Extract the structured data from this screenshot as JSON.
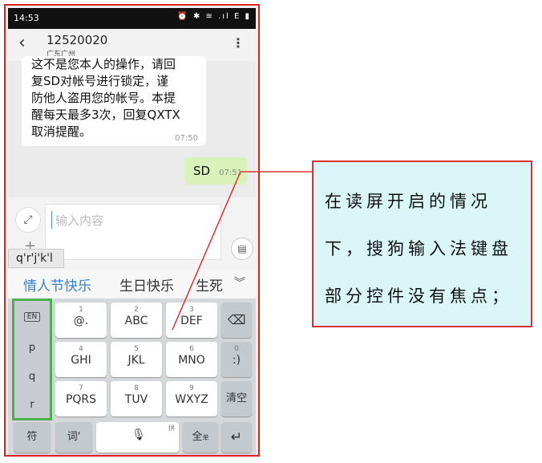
{
  "status": {
    "time": "14:53",
    "icons": "⏰ ✱ ≋ .ıl E ▮"
  },
  "appbar": {
    "number": "12520020",
    "location": "广东广州"
  },
  "messages": {
    "incoming": {
      "lines": [
        "这不是您本人的操作，请回",
        "复SD对帐号进行锁定，谨",
        "防他人盗用您的帐号。本提",
        "醒每天最多3次，回复QXTX",
        "取消提醒。"
      ],
      "time": "07:50"
    },
    "outgoing": {
      "text": "SD",
      "time": "07:51"
    }
  },
  "composer": {
    "placeholder": "输入内容"
  },
  "ime": {
    "pinyin": "q'r'j'k'l",
    "candidates": [
      "情人节快乐",
      "生日快乐",
      "生死"
    ],
    "side": [
      "EN",
      "p",
      "q",
      "r"
    ],
    "keys": [
      {
        "num": "1",
        "lbl": "@."
      },
      {
        "num": "2",
        "lbl": "ABC"
      },
      {
        "num": "3",
        "lbl": "DEF"
      },
      {
        "num": "4",
        "lbl": "GHI"
      },
      {
        "num": "5",
        "lbl": "JKL"
      },
      {
        "num": "6",
        "lbl": "MNO"
      },
      {
        "num": "7",
        "lbl": "PQRS"
      },
      {
        "num": "8",
        "lbl": "TUV"
      },
      {
        "num": "9",
        "lbl": "WXYZ"
      }
    ],
    "zero_key": {
      "num": "0",
      "lbl": ":)"
    },
    "clear": "清空",
    "symbols": "符",
    "words": "词'",
    "space_tag": "拼",
    "fullwidth": "全",
    "fullwidth_sub": "单"
  },
  "callout": {
    "lines": [
      "在读屏开启的情况",
      "下，搜狗输入法键盘",
      "部分控件没有焦点；"
    ]
  },
  "colors": {
    "frame": "#e02020",
    "highlight": "#4caf50",
    "callout_bg": "#dbf6f9",
    "candidate": "#3a7fd0"
  }
}
